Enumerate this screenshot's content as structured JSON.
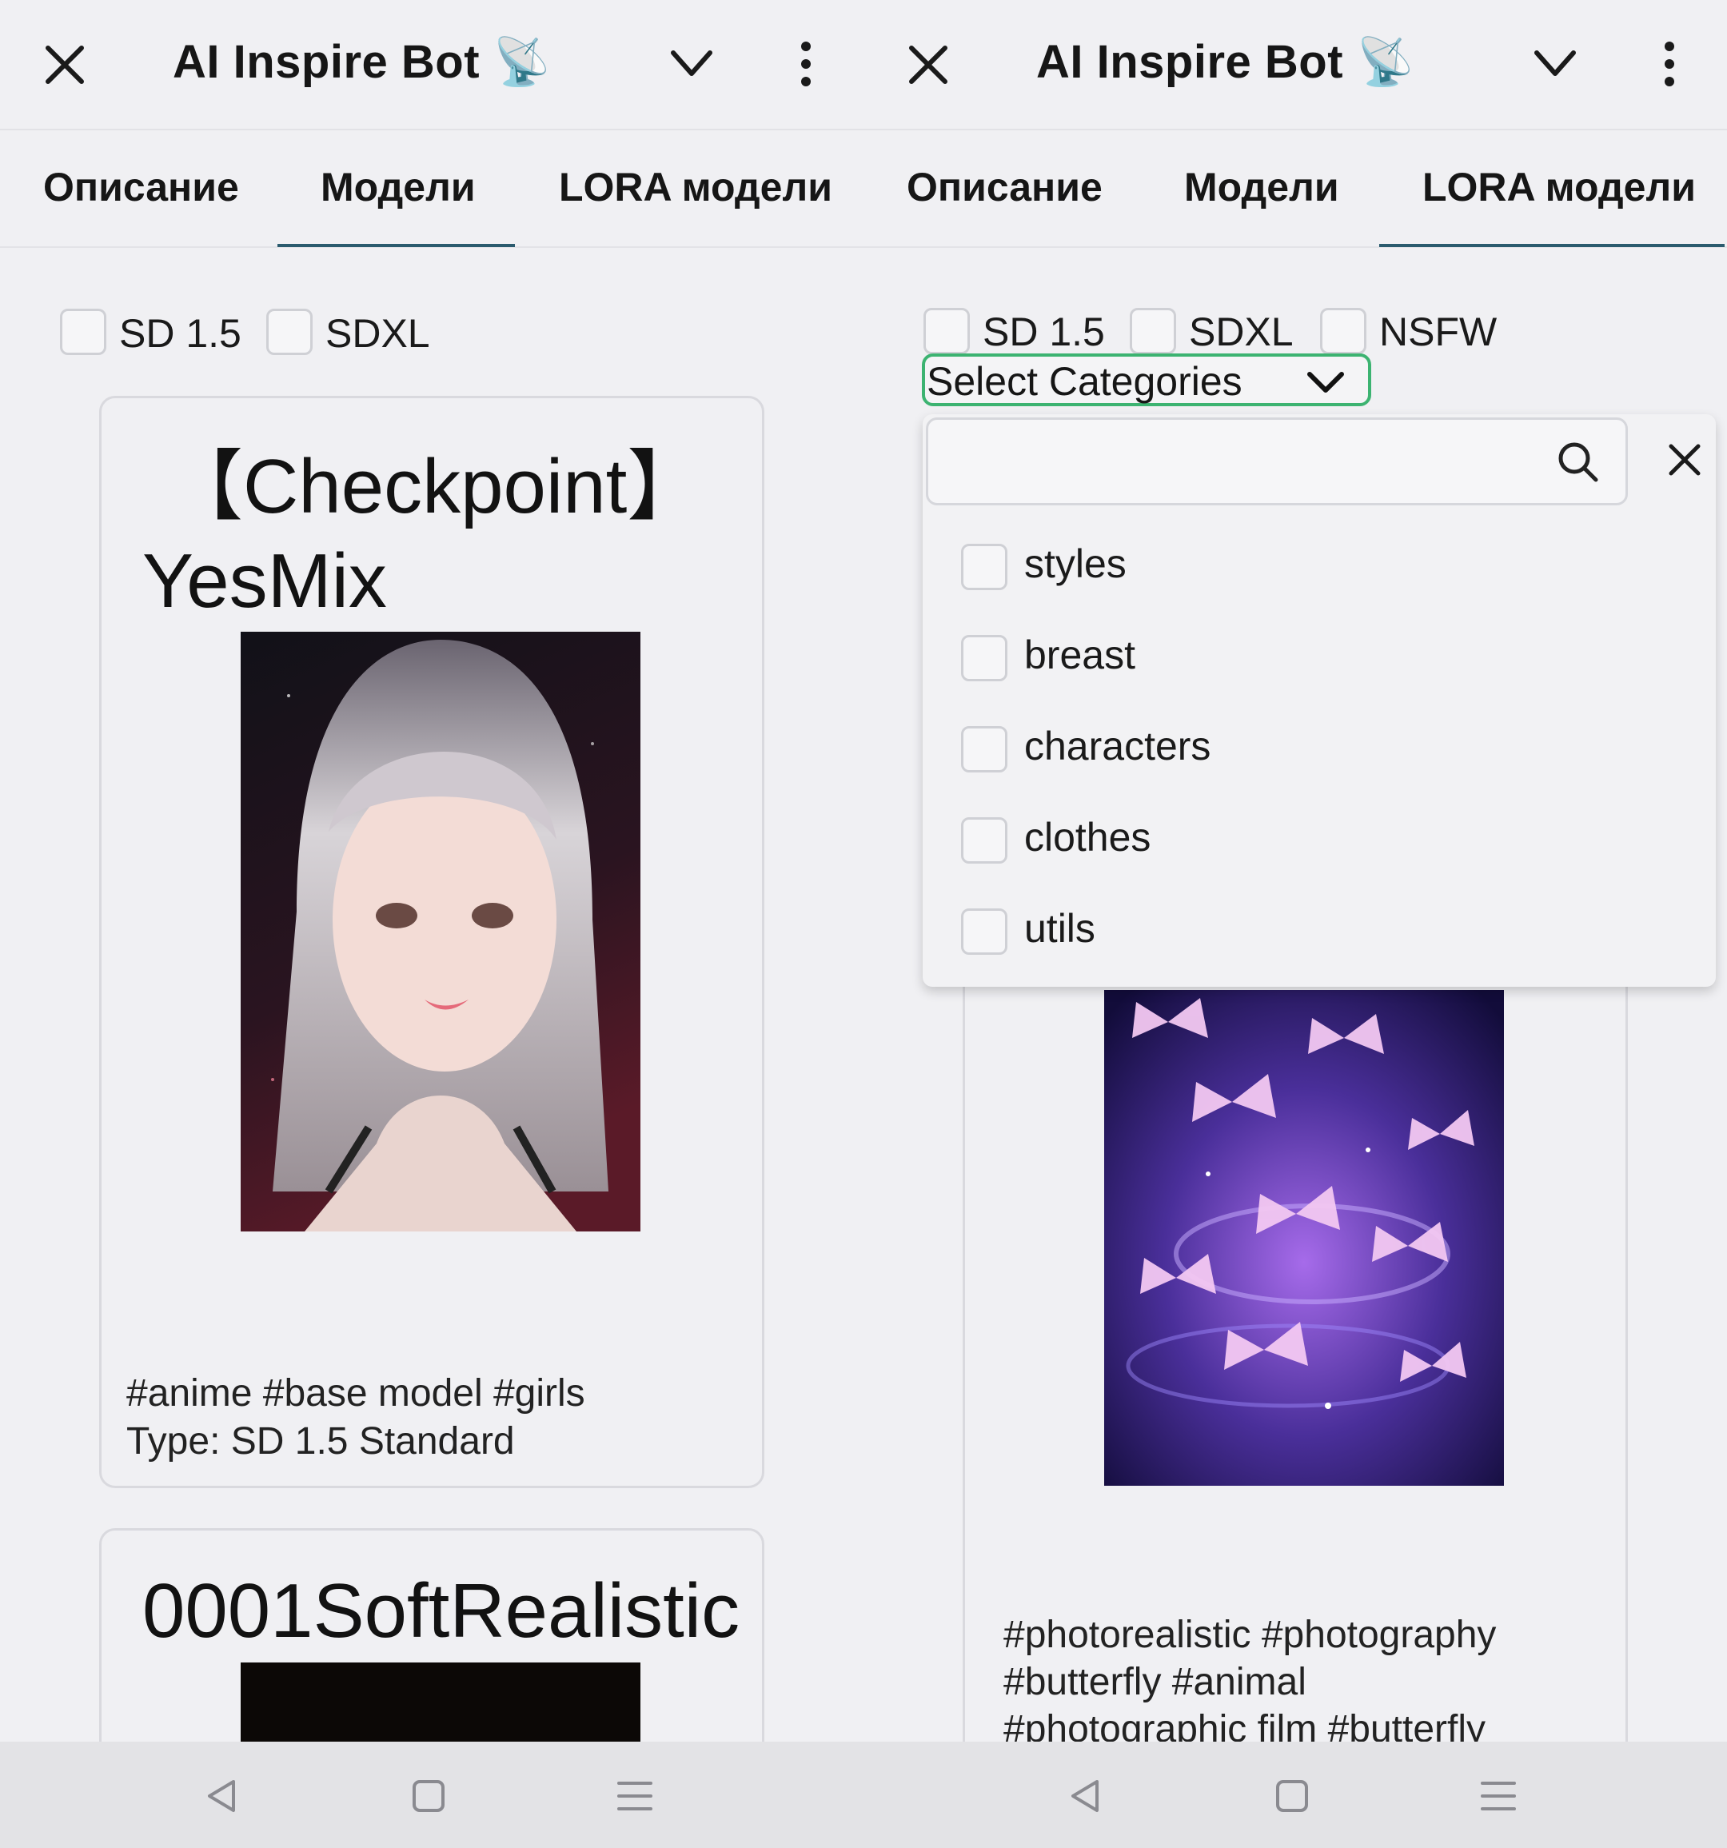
{
  "left": {
    "header": {
      "title": "AI Inspire Bot",
      "emoji": "📡"
    },
    "tabs": [
      {
        "label": "Описание"
      },
      {
        "label": "Модели"
      },
      {
        "label": "LORA модели"
      }
    ],
    "active_tab": "Модели",
    "filters": [
      {
        "label": "SD 1.5",
        "checked": false
      },
      {
        "label": "SDXL",
        "checked": false
      }
    ],
    "cards": [
      {
        "title_line1": "【Checkpoint】",
        "title_line2": "YesMix",
        "image": "anime-girl-silver-hair-portrait",
        "tags": "#anime #base model #girls",
        "type": "Type: SD 1.5 Standard"
      },
      {
        "title_line1": "0001SoftRealistic",
        "image": "dark-portrait"
      }
    ]
  },
  "right": {
    "header": {
      "title": "AI Inspire Bot",
      "emoji": "📡"
    },
    "tabs": [
      {
        "label": "Описание"
      },
      {
        "label": "Модели"
      },
      {
        "label": "LORA модели"
      }
    ],
    "active_tab": "LORA модели",
    "filters": [
      {
        "label": "SD 1.5",
        "checked": false
      },
      {
        "label": "SDXL",
        "checked": false
      },
      {
        "label": "NSFW",
        "checked": false
      }
    ],
    "select": {
      "label": "Select Categories"
    },
    "dropdown": {
      "search_value": "",
      "items": [
        {
          "label": "styles",
          "checked": false
        },
        {
          "label": "breast",
          "checked": false
        },
        {
          "label": "characters",
          "checked": false
        },
        {
          "label": "clothes",
          "checked": false
        },
        {
          "label": "utils",
          "checked": false
        }
      ]
    },
    "card": {
      "image": "purple-butterflies-over-water",
      "tags_line1": "#photorealistic #photography",
      "tags_line2": "#butterfly #animal",
      "tags_line3": "#photographic film #butterfly"
    }
  },
  "colors": {
    "background": "#f0f0f3",
    "accent_tab": "#2b5b6e",
    "select_border": "#3cb371",
    "navbar": "#e3e3e6"
  },
  "navbar": {
    "icons": [
      "back-icon",
      "home-icon",
      "recents-icon"
    ]
  }
}
